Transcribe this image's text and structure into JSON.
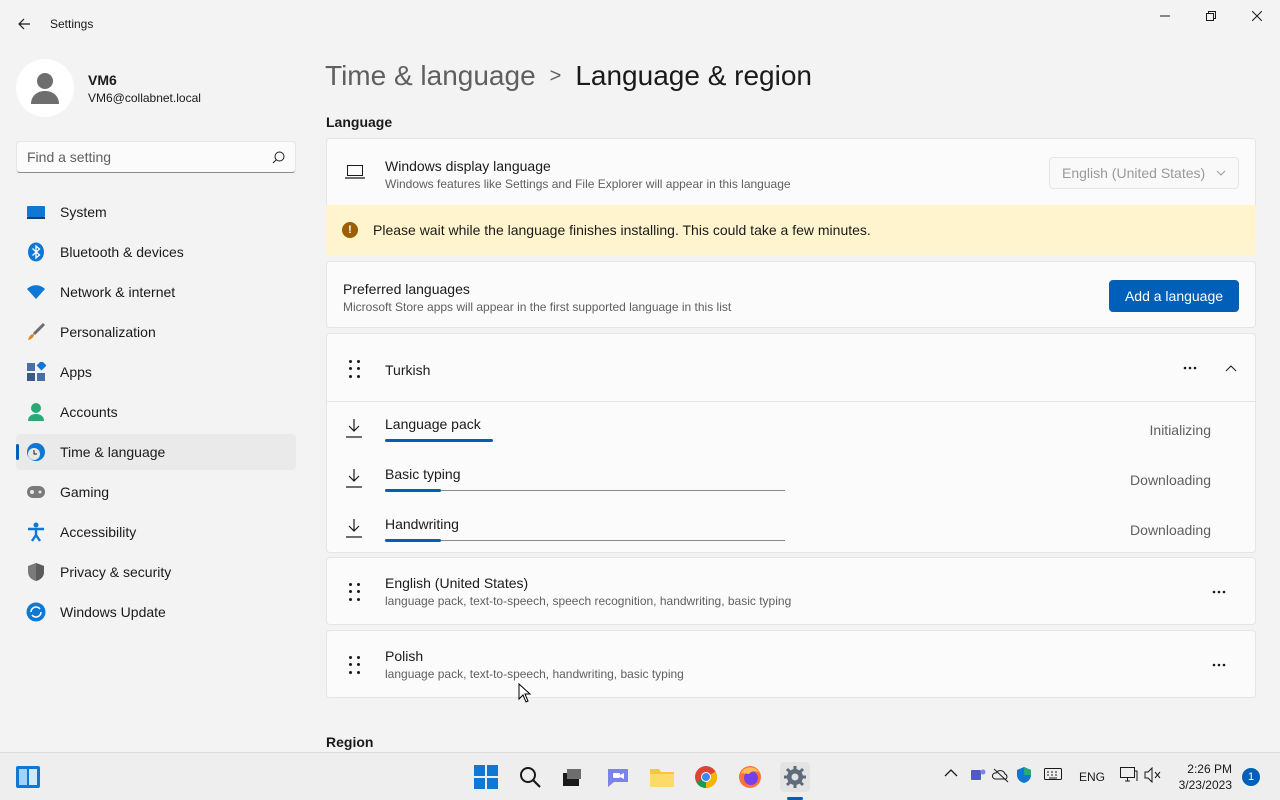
{
  "window": {
    "app_title": "Settings",
    "controls": [
      "minimize",
      "maximize",
      "close"
    ]
  },
  "profile": {
    "name": "VM6",
    "email": "VM6@collabnet.local"
  },
  "search": {
    "placeholder": "Find a setting"
  },
  "sidebar": {
    "items": [
      {
        "label": "System",
        "icon": "system-icon"
      },
      {
        "label": "Bluetooth & devices",
        "icon": "bluetooth-icon"
      },
      {
        "label": "Network & internet",
        "icon": "wifi-icon"
      },
      {
        "label": "Personalization",
        "icon": "brush-icon"
      },
      {
        "label": "Apps",
        "icon": "apps-icon"
      },
      {
        "label": "Accounts",
        "icon": "accounts-icon"
      },
      {
        "label": "Time & language",
        "icon": "time-language-icon",
        "active": true
      },
      {
        "label": "Gaming",
        "icon": "gamepad-icon"
      },
      {
        "label": "Accessibility",
        "icon": "accessibility-icon"
      },
      {
        "label": "Privacy & security",
        "icon": "shield-icon"
      },
      {
        "label": "Windows Update",
        "icon": "update-icon"
      }
    ]
  },
  "breadcrumb": {
    "parent": "Time & language",
    "separator": ">",
    "current": "Language & region"
  },
  "language_section": {
    "title": "Language",
    "display_language": {
      "title": "Windows display language",
      "subtitle": "Windows features like Settings and File Explorer will appear in this language",
      "selected": "English (United States)"
    },
    "warning": "Please wait while the language finishes installing. This could take a few minutes.",
    "preferred": {
      "title": "Preferred languages",
      "subtitle": "Microsoft Store apps will appear in the first supported language in this list",
      "add_button": "Add a language"
    },
    "languages": [
      {
        "name": "Turkish",
        "expanded": true,
        "features": [
          {
            "name": "Language pack",
            "status": "Initializing",
            "progress": 0.27
          },
          {
            "name": "Basic typing",
            "status": "Downloading",
            "progress": 0.14
          },
          {
            "name": "Handwriting",
            "status": "Downloading",
            "progress": 0.14
          }
        ]
      },
      {
        "name": "English (United States)",
        "details": "language pack, text-to-speech, speech recognition, handwriting, basic typing"
      },
      {
        "name": "Polish",
        "details": "language pack, text-to-speech, handwriting, basic typing"
      }
    ]
  },
  "region_section": {
    "title": "Region"
  },
  "taskbar": {
    "apps": [
      "start-icon",
      "search-icon",
      "task-view-icon",
      "chat-icon",
      "file-explorer-icon",
      "chrome-icon",
      "firefox-icon",
      "settings-icon"
    ],
    "language": "ENG",
    "time": "2:26 PM",
    "date": "3/23/2023",
    "notification_count": "1"
  },
  "colors": {
    "accent": "#005fb8",
    "warning_bg": "#fff4ce",
    "warning_icon": "#9d5d00"
  }
}
